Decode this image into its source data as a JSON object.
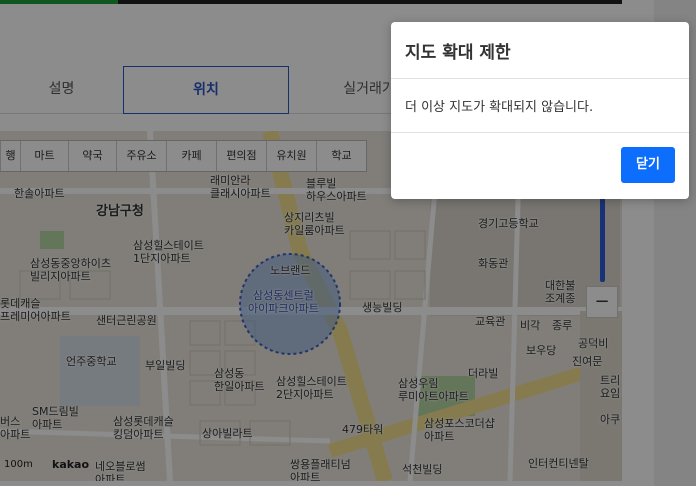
{
  "tabs": [
    {
      "label": "설명"
    },
    {
      "label": "위치"
    },
    {
      "label": "실거래가"
    }
  ],
  "map": {
    "categories": [
      "행",
      "마트",
      "약국",
      "주유소",
      "카페",
      "편의점",
      "유치원",
      "학교"
    ],
    "labels": {
      "gangnam": "강남구청",
      "hansol": "한솔아파트",
      "samsung_dongjung": "삼성동중앙하이츠\n빌리지아파트",
      "samsung_hillstate1": "삼성힐스테이트\n1단지아파트",
      "ramian": "래미안라\n클래시아파트",
      "blueville": "블루빌\n하우스아파트",
      "sangji": "상지리츠빌\n카일룸아파트",
      "lotte_castle": "롯데캐슬\n프레미어아파트",
      "center_park": "샌터근린공원",
      "yeonju": "언주중학교",
      "buil": "부일빌딩",
      "samsung_hanil": "삼성동\n한일아파트",
      "samsung_hillstate2": "삼성힐스테이트\n2단지아파트",
      "saengneung": "생능빌딩",
      "gyeonggi_high": "경기고등학교",
      "hwado": "화동관",
      "daehan": "대한불\n조계종",
      "education": "교육관",
      "bigak": "비각",
      "jongru": "종루",
      "bowoodang": "보우당",
      "gongdeok": "공덕비",
      "jinyeo": "진여문",
      "deoreble": "더라빌",
      "samsung_woorim": "삼성우림\n루미아트아파트",
      "sm_dream": "SM드림빌\n아파트",
      "lotte_king": "삼성롯데캐슬\n킹덤아파트",
      "sangah": "상아빌라트",
      "samsung_sports": "삼성포스코더샵\n아파트",
      "479": "479타워",
      "ssangyong": "쌍용플래티넘\n아파트",
      "seokcheon": "석천빌딩",
      "intercontinental": "인터컨티넨탈",
      "nebul": "네오블로썸\n아파트",
      "buss": "버스\n아파트",
      "noble": "노브랜드",
      "trio": "트리\n요임",
      "arco": "아쿠",
      "samsung_center": "삼성동센트럴\n아이파크아파트"
    },
    "zoom_minus": "−",
    "scale": "100m",
    "provider": "kakao"
  },
  "dialog": {
    "title": "지도 확대 제한",
    "message": "더 이상 지도가 확대되지 않습니다.",
    "close_label": "닫기"
  },
  "colors": {
    "accent": "#0d6efd",
    "tab_active": "#2a56c6"
  }
}
